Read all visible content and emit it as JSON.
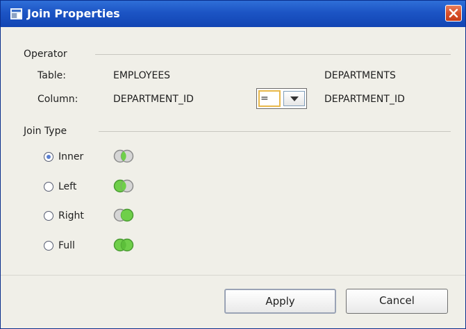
{
  "window": {
    "title": "Join Properties"
  },
  "operator": {
    "section_label": "Operator",
    "table_label": "Table:",
    "left_table": "EMPLOYEES",
    "right_table": "DEPARTMENTS",
    "column_label": "Column:",
    "left_column": "DEPARTMENT_ID",
    "operator_value": "=",
    "right_column": "DEPARTMENT_ID"
  },
  "join_type": {
    "section_label": "Join Type",
    "options": [
      {
        "label": "Inner",
        "selected": true,
        "icon": "inner-join-icon"
      },
      {
        "label": "Left",
        "selected": false,
        "icon": "left-join-icon"
      },
      {
        "label": "Right",
        "selected": false,
        "icon": "right-join-icon"
      },
      {
        "label": "Full",
        "selected": false,
        "icon": "full-join-icon"
      }
    ]
  },
  "buttons": {
    "apply": "Apply",
    "cancel": "Cancel"
  },
  "colors": {
    "title_bar": "#1c54c4",
    "join_fill": "#6fcf4a",
    "join_gray": "#a9a9a9"
  }
}
